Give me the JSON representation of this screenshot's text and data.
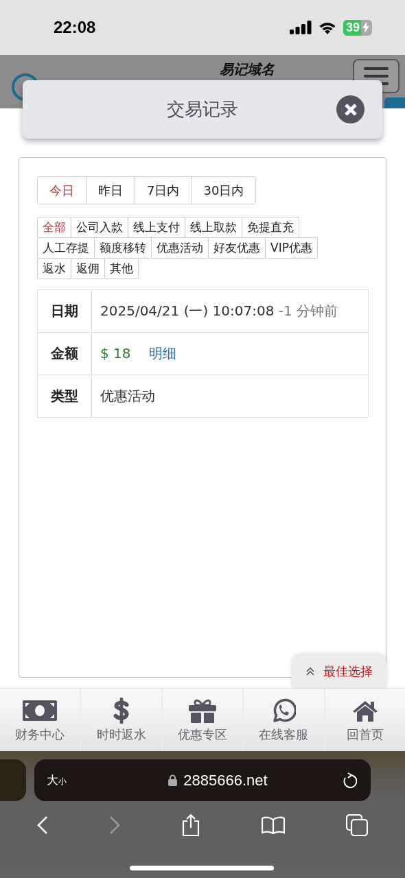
{
  "status_bar": {
    "time": "22:08",
    "battery": "39"
  },
  "site_header": {
    "title": "易记域名"
  },
  "dialog": {
    "title": "交易记录"
  },
  "period_tabs": [
    {
      "label": "今日",
      "selected": true
    },
    {
      "label": "昨日",
      "selected": false
    },
    {
      "label": "7日内",
      "selected": false
    },
    {
      "label": "30日内",
      "selected": false
    }
  ],
  "category_filters": [
    [
      {
        "label": "全部",
        "selected": true
      },
      {
        "label": "公司入款",
        "selected": false
      },
      {
        "label": "线上支付",
        "selected": false
      },
      {
        "label": "线上取款",
        "selected": false
      },
      {
        "label": "免提直充",
        "selected": false
      }
    ],
    [
      {
        "label": "人工存提",
        "selected": false
      },
      {
        "label": "额度移转",
        "selected": false
      },
      {
        "label": "优惠活动",
        "selected": false
      },
      {
        "label": "好友优惠",
        "selected": false
      },
      {
        "label": "VIP优惠",
        "selected": false
      }
    ],
    [
      {
        "label": "返水",
        "selected": false
      },
      {
        "label": "返佣",
        "selected": false
      },
      {
        "label": "其他",
        "selected": false
      }
    ]
  ],
  "record": [
    {
      "kind": "datetime",
      "label": "日期",
      "value": "2025/04/21 (一) 10:07:08",
      "note": "-1 分钟前"
    },
    {
      "kind": "amount",
      "label": "金额",
      "value": "$ 18",
      "link": "明细"
    },
    {
      "kind": "text",
      "label": "类型",
      "value": "优惠活动"
    }
  ],
  "floating_button": {
    "label": "最佳选择"
  },
  "bottom_nav": [
    {
      "label": "财务中心"
    },
    {
      "label": "时时返水"
    },
    {
      "label": "优惠专区"
    },
    {
      "label": "在线客服"
    },
    {
      "label": "回首页"
    }
  ],
  "browser": {
    "text_size_large": "大",
    "text_size_small": "小",
    "url": "2885666.net"
  }
}
